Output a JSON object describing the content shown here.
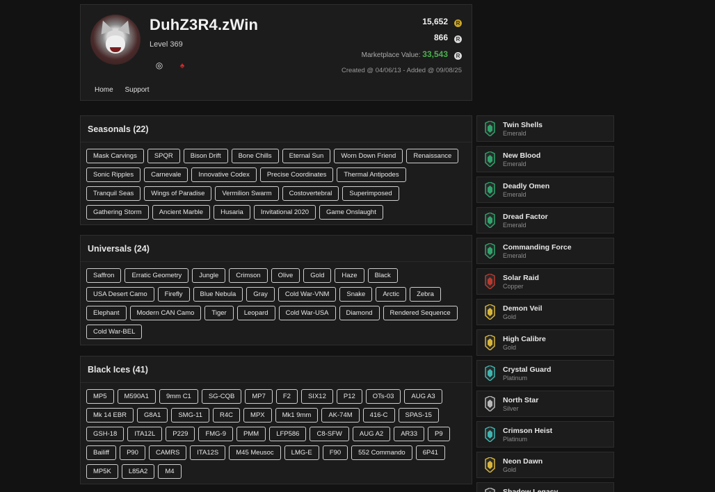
{
  "profile": {
    "username": "DuhZ3R4.zWin",
    "level": "Level 369",
    "renown": "15,652",
    "credits": "866",
    "market_label": "Marketplace Value:",
    "market_value": "33,543",
    "created": "Created @ 04/06/13 - Added @ 09/08/25",
    "nav": [
      "Home",
      "Support"
    ],
    "platforms": [
      "ubisoft-icon",
      "playstation-icon"
    ],
    "colors": {
      "accent_green": "#4caf50",
      "psn_red": "#d12a2a",
      "renown_gold": "#c9a52a"
    }
  },
  "seasonals": {
    "title": "Seasonals (22)",
    "items": [
      "Mask Carvings",
      "SPQR",
      "Bison Drift",
      "Bone Chills",
      "Eternal Sun",
      "Worn Down Friend",
      "Renaissance",
      "Sonic Ripples",
      "Carnevale",
      "Innovative Codex",
      "Precise Coordinates",
      "Thermal Antipodes",
      "Tranquil Seas",
      "Wings of Paradise",
      "Vermilion Swarm",
      "Costovertebral",
      "Superimposed",
      "Gathering Storm",
      "Ancient Marble",
      "Husaria",
      "Invitational 2020",
      "Game Onslaught"
    ]
  },
  "universals": {
    "title": "Universals (24)",
    "items": [
      "Saffron",
      "Erratic Geometry",
      "Jungle",
      "Crimson",
      "Olive",
      "Gold",
      "Haze",
      "Black",
      "USA Desert Camo",
      "Firefly",
      "Blue Nebula",
      "Gray",
      "Cold War-VNM",
      "Snake",
      "Arctic",
      "Zebra",
      "Elephant",
      "Modern CAN Camo",
      "Tiger",
      "Leopard",
      "Cold War-USA",
      "Diamond",
      "Rendered Sequence",
      "Cold War-BEL"
    ]
  },
  "blackices": {
    "title": "Black Ices (41)",
    "items": [
      "MP5",
      "M590A1",
      "9mm C1",
      "SG-CQB",
      "MP7",
      "F2",
      "SIX12",
      "P12",
      "OTs-03",
      "AUG A3",
      "Mk 14 EBR",
      "G8A1",
      "SMG-11",
      "R4C",
      "MPX",
      "Mk1 9mm",
      "AK-74M",
      "416-C",
      "SPAS-15",
      "GSH-18",
      "ITA12L",
      "P229",
      "FMG-9",
      "PMM",
      "LFP586",
      "C8-SFW",
      "AUG A2",
      "AR33",
      "P9",
      "Bailiff",
      "P90",
      "CAMRS",
      "ITA12S",
      "M45 Meusoc",
      "LMG-E",
      "F90",
      "552 Commando",
      "6P41",
      "MP5K",
      "L85A2",
      "M4"
    ]
  },
  "charms": [
    {
      "name": "Twin Shells",
      "tier": "Emerald",
      "color": "#2fa36b"
    },
    {
      "name": "New Blood",
      "tier": "Emerald",
      "color": "#2fa36b"
    },
    {
      "name": "Deadly Omen",
      "tier": "Emerald",
      "color": "#2fa36b"
    },
    {
      "name": "Dread Factor",
      "tier": "Emerald",
      "color": "#2fa36b"
    },
    {
      "name": "Commanding Force",
      "tier": "Emerald",
      "color": "#2fa36b"
    },
    {
      "name": "Solar Raid",
      "tier": "Copper",
      "color": "#b83a2e"
    },
    {
      "name": "Demon Veil",
      "tier": "Gold",
      "color": "#d7b53a"
    },
    {
      "name": "High Calibre",
      "tier": "Gold",
      "color": "#d7b53a"
    },
    {
      "name": "Crystal Guard",
      "tier": "Platinum",
      "color": "#3fb5b0"
    },
    {
      "name": "North Star",
      "tier": "Silver",
      "color": "#b9b9b9"
    },
    {
      "name": "Crimson Heist",
      "tier": "Platinum",
      "color": "#3fb5b0"
    },
    {
      "name": "Neon Dawn",
      "tier": "Gold",
      "color": "#d7b53a"
    },
    {
      "name": "Shadow Legacy",
      "tier": "",
      "color": "#b9b9b9"
    }
  ]
}
